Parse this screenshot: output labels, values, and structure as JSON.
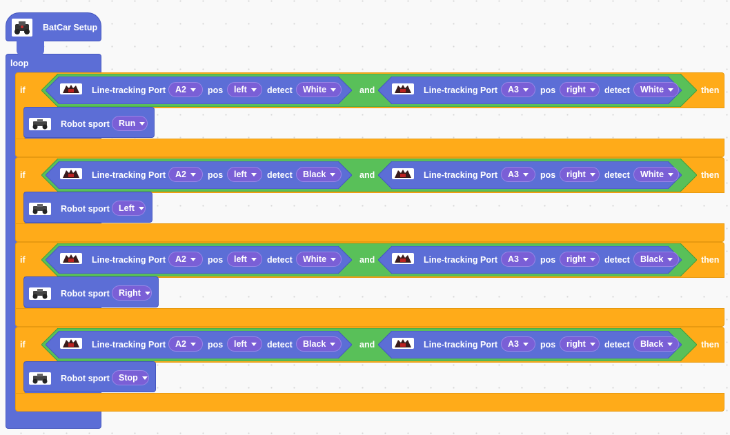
{
  "setup": {
    "label": "BatCar Setup",
    "icon": "batcar-robot-icon"
  },
  "loop": {
    "label": "loop"
  },
  "keywords": {
    "if": "if",
    "then": "then",
    "and": "and",
    "line_tracking": "Line-tracking",
    "port": "Port",
    "pos": "pos",
    "detect": "detect",
    "robot_sport": "Robot sport"
  },
  "rows": [
    {
      "left": {
        "port": "A2",
        "pos": "left",
        "detect": "White"
      },
      "right": {
        "port": "A3",
        "pos": "right",
        "detect": "White"
      },
      "action": "Run"
    },
    {
      "left": {
        "port": "A2",
        "pos": "left",
        "detect": "Black"
      },
      "right": {
        "port": "A3",
        "pos": "right",
        "detect": "White"
      },
      "action": "Left"
    },
    {
      "left": {
        "port": "A2",
        "pos": "left",
        "detect": "White"
      },
      "right": {
        "port": "A3",
        "pos": "right",
        "detect": "Black"
      },
      "action": "Right"
    },
    {
      "left": {
        "port": "A2",
        "pos": "left",
        "detect": "Black"
      },
      "right": {
        "port": "A3",
        "pos": "right",
        "detect": "Black"
      },
      "action": "Stop"
    }
  ],
  "colors": {
    "workspace": "#f9f9f9",
    "event_block": "#5c6ed6",
    "control": "#ffab19",
    "operator": "#59c059",
    "dropdown": "#7a5fd6"
  }
}
